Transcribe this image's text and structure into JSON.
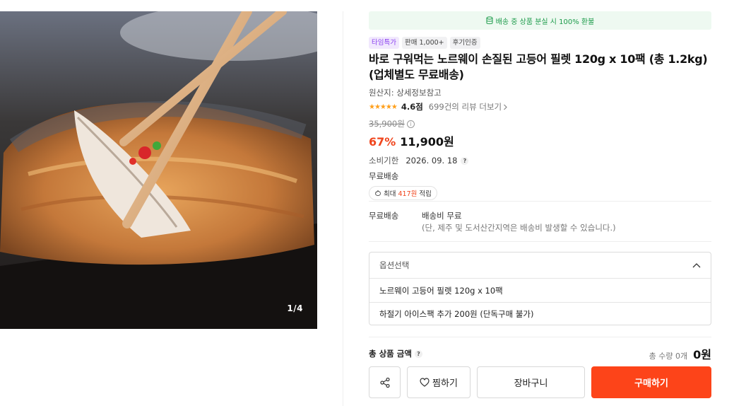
{
  "gallery": {
    "page_indicator": "1/4"
  },
  "product": {
    "guarantee": "배송 중 상품 분실 시 100% 환불",
    "badges": [
      "타임특가",
      "판매 1,000+",
      "후기인증"
    ],
    "title_line1": "바로 구워먹는 노르웨이 손질된 고등어 필렛 120g x 10팩 (총 1.2kg)",
    "title_line2": "(업체별도 무료배송)",
    "origin": "원산지: 상세정보참고",
    "stars": "★★★★★",
    "rating": "4.6점",
    "review_link": "699건의 리뷰 더보기",
    "original_price": "35,900원",
    "discount": "67%",
    "price": "11,900원",
    "expiry_label": "소비기한",
    "expiry_value": "2026. 09. 18",
    "free_shipping": "무료배송",
    "point_prefix": "최대",
    "point_amount": "417원",
    "point_suffix": "적립"
  },
  "shipping": {
    "label": "무료배송",
    "value": "배송비 무료",
    "note": "(단, 제주 및 도서산간지역은 배송비 발생할 수 있습니다.)"
  },
  "options": {
    "header": "옵션선택",
    "items": [
      "노르웨이 고등어 필렛 120g x 10팩",
      "하절기 아이스팩 추가 200원 (단독구매 불가)"
    ]
  },
  "total": {
    "label": "총 상품 금액",
    "qty": "총 수량 0개",
    "amount": "0원"
  },
  "buttons": {
    "wish": "찜하기",
    "cart": "장바구니",
    "buy": "구매하기"
  },
  "colors": {
    "accent": "#fd4419",
    "discount": "#f0461e",
    "guarantee": "#1c9b4a",
    "badge_purple": "#8a3ff0"
  }
}
